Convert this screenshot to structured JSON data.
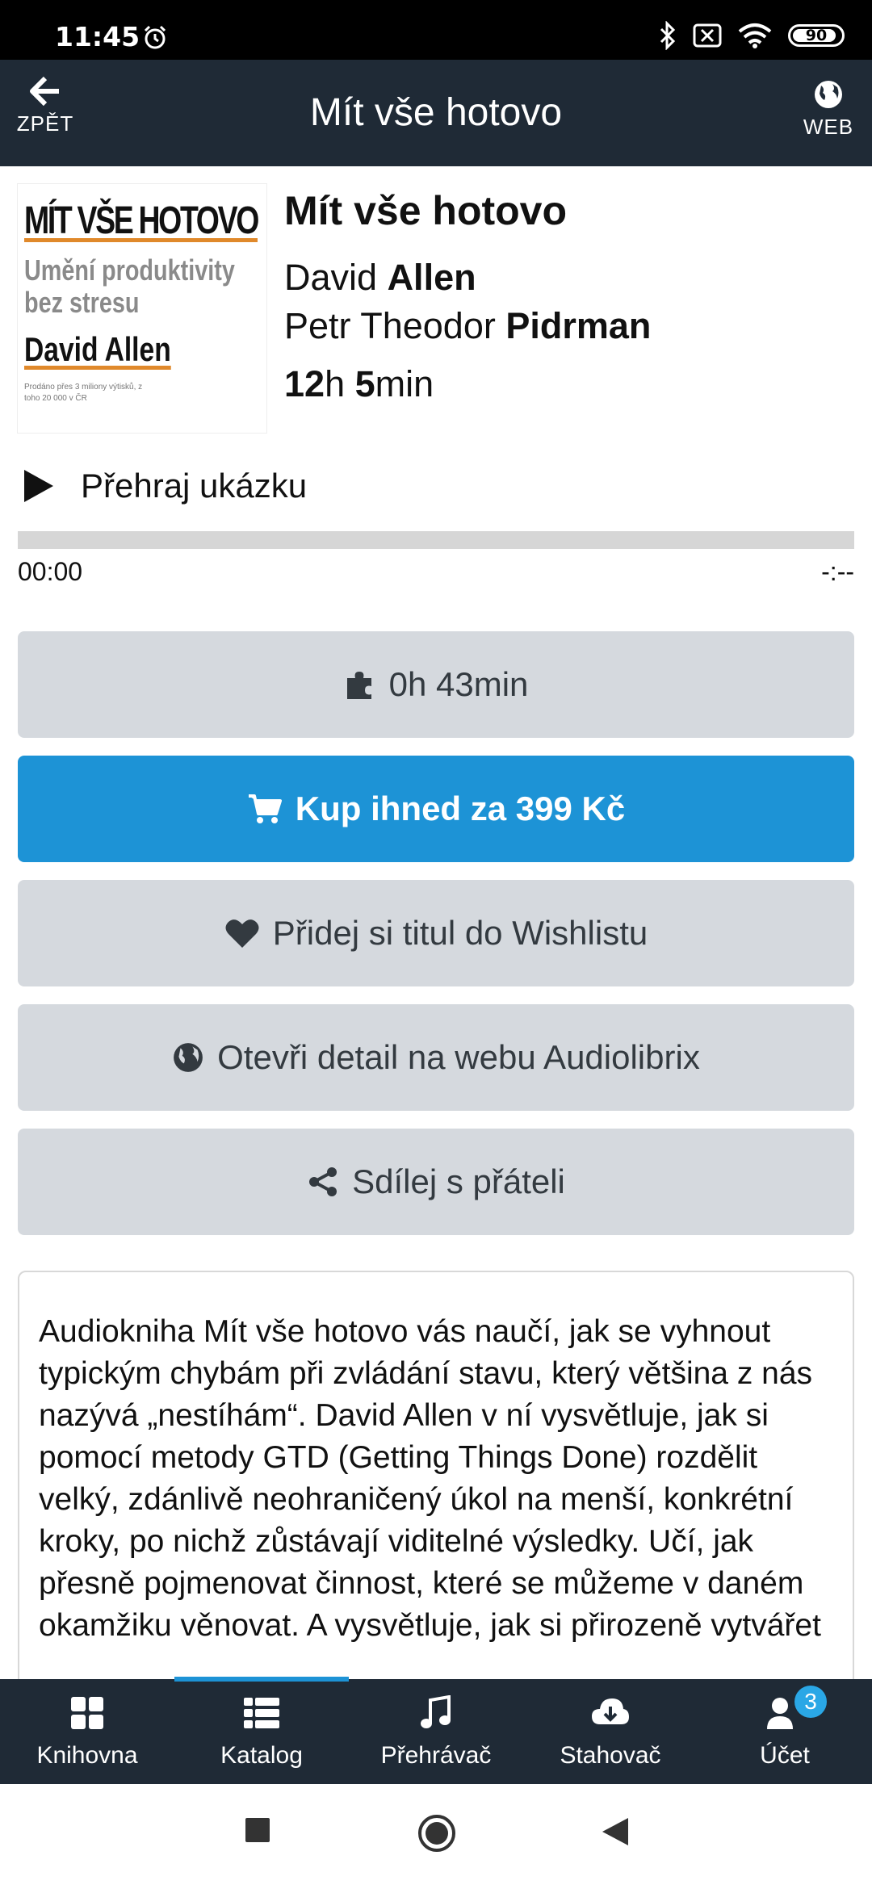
{
  "status_bar": {
    "time": "11:45",
    "battery": "90"
  },
  "header": {
    "back_label": "ZPĚT",
    "title": "Mít vše hotovo",
    "web_label": "WEB"
  },
  "cover": {
    "title": "MÍT VŠE HOTOVO",
    "subtitle": "Umění produktivity bez stresu",
    "author": "David Allen",
    "note": "Prodáno přes 3 miliony výtisků, z toho 20 000 v ČR"
  },
  "book": {
    "title": "Mít vše hotovo",
    "author_first": "David ",
    "author_last": "Allen",
    "narrator_first": "Petr Theodor ",
    "narrator_last": "Pidrman",
    "duration_h": "12",
    "duration_h_unit": "h ",
    "duration_m": "5",
    "duration_m_unit": "min"
  },
  "sample": {
    "label": "Přehraj ukázku",
    "current_time": "00:00",
    "total_time": "-:--",
    "progress": 0
  },
  "buttons": {
    "sample_length": "0h 43min",
    "buy": "Kup ihned za 399 Kč",
    "wishlist": "Přidej si titul do Wishlistu",
    "open_web": "Otevři detail na webu Audiolibrix",
    "share": "Sdílej s přáteli"
  },
  "description": "Audiokniha Mít vše hotovo vás naučí, jak se vyhnout typickým chybám při zvládání stavu, který většina z nás nazývá „nestíhám“. David Allen v ní vysvětluje, jak si pomocí metody GTD (Getting Things Done) rozdělit velký, zdánlivě neohraničený úkol na menší, konkrétní kroky, po nichž zůstávají viditelné výsledky. Učí, jak přesně pojmenovat činnost, které se můžeme v daném okamžiku věnovat. A vysvětluje, jak si přirozeně vytvářet",
  "bottom_nav": {
    "items": [
      {
        "label": "Knihovna",
        "icon": "grid-icon"
      },
      {
        "label": "Katalog",
        "icon": "list-icon"
      },
      {
        "label": "Přehrávač",
        "icon": "music-note-icon"
      },
      {
        "label": "Stahovač",
        "icon": "cloud-download-icon"
      },
      {
        "label": "Účet",
        "icon": "users-icon",
        "badge": "3"
      }
    ],
    "active_index": 1
  },
  "colors": {
    "header_bg": "#1f2a36",
    "primary": "#1d93d6",
    "button_bg": "#d5d9de",
    "cover_accent": "#e0892b"
  }
}
